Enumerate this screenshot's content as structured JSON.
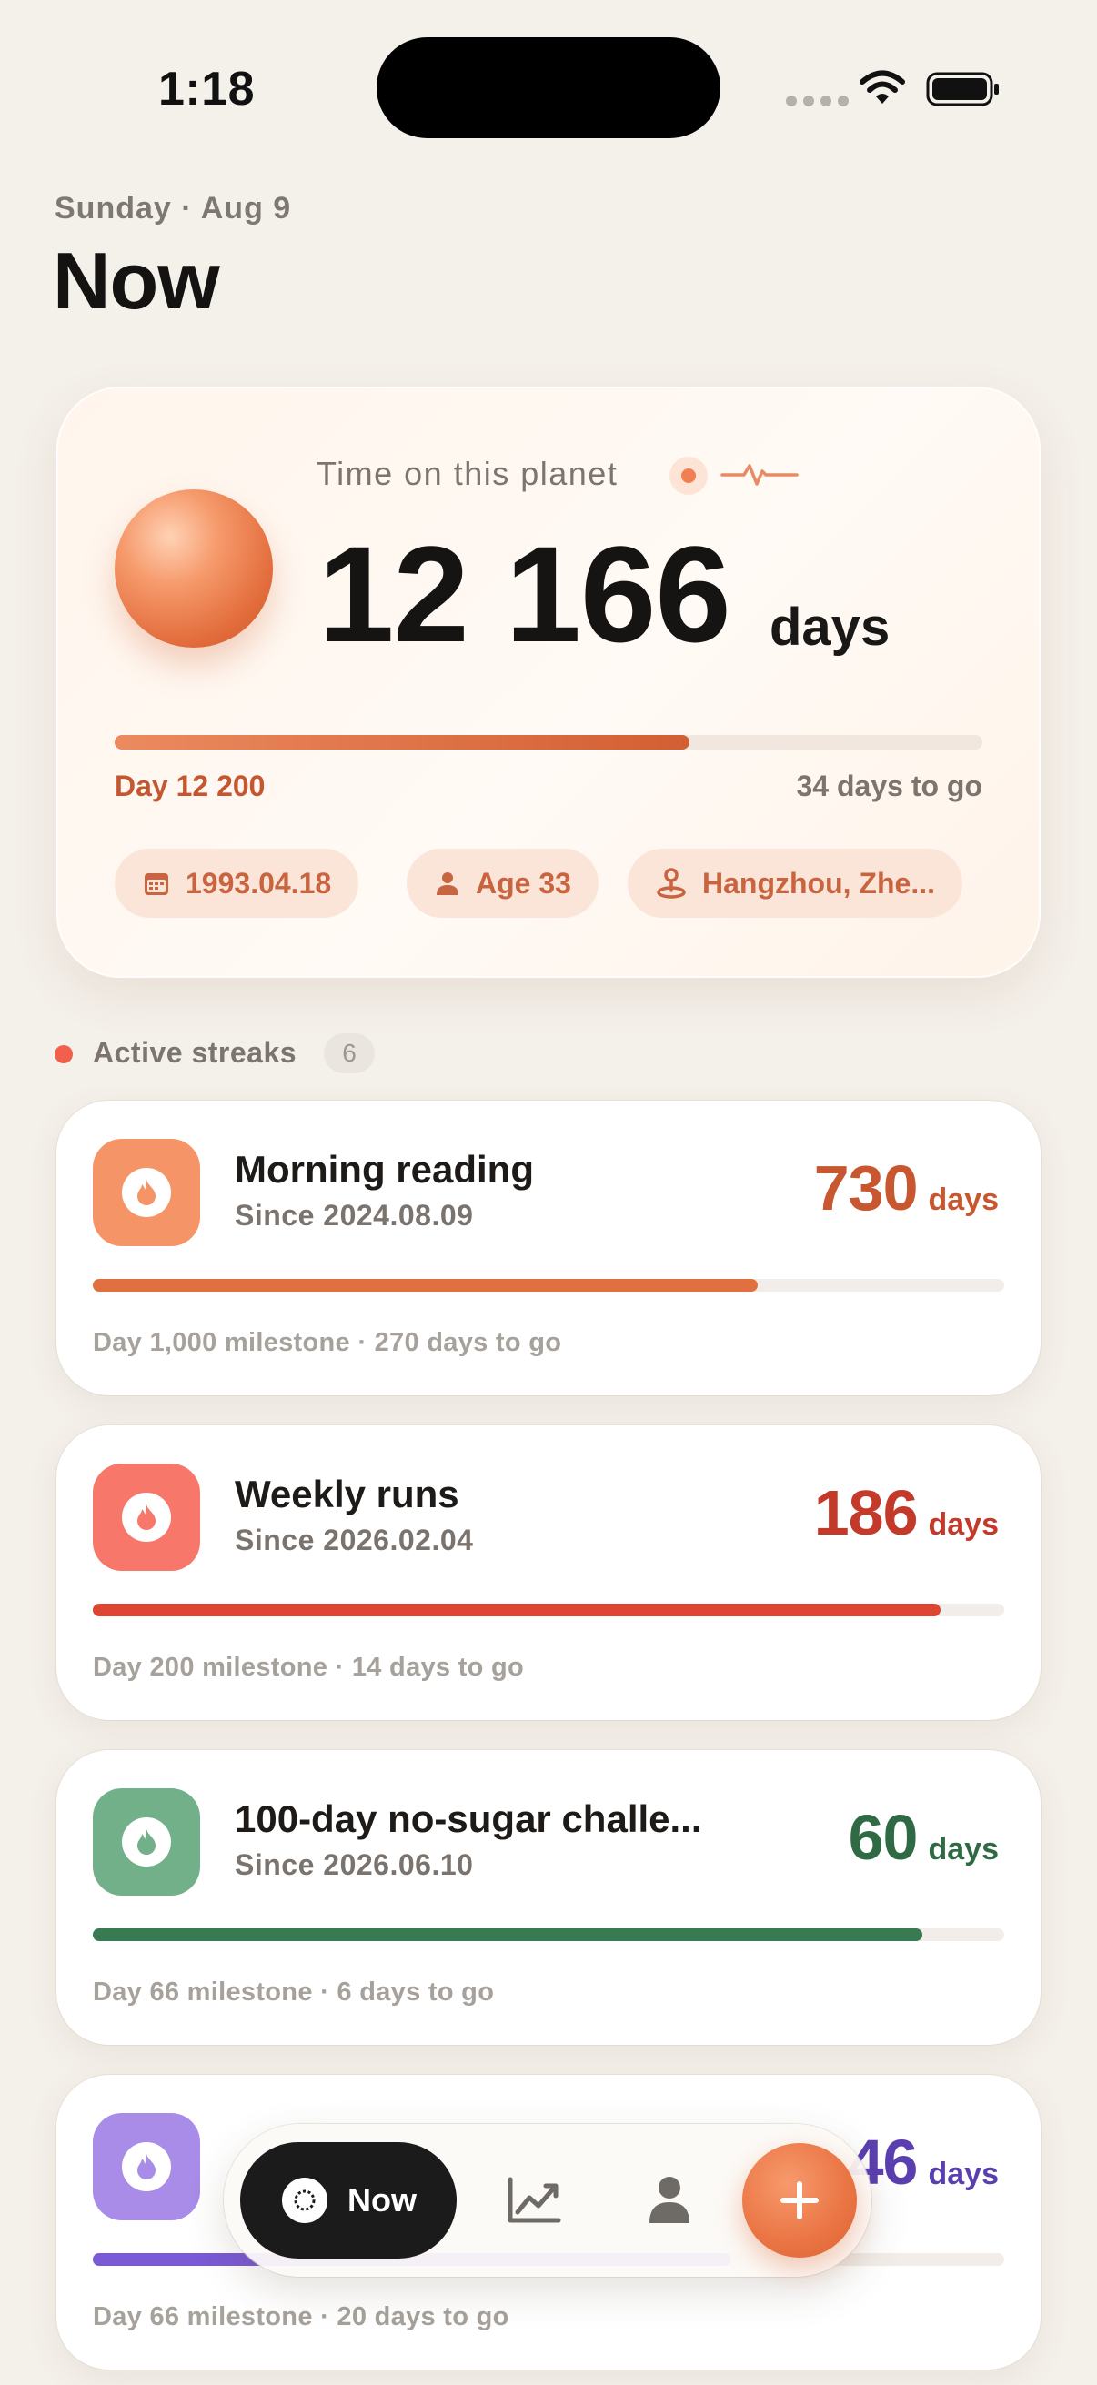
{
  "status_bar": {
    "time": "1:18"
  },
  "header": {
    "date": "Sunday · Aug 9",
    "title": "Now"
  },
  "hero": {
    "label": "Time on this planet",
    "value": "12 166",
    "unit": "days",
    "progress": 0.662,
    "milestone": "Day 12 200",
    "remaining": "34 days to go",
    "chips": [
      {
        "icon": "calendar-icon",
        "text": "1993.04.18"
      },
      {
        "icon": "person-icon",
        "text": "Age 33"
      },
      {
        "icon": "location-pin-icon",
        "text": "Hangzhou, Zhe..."
      }
    ]
  },
  "streaks_section": {
    "title": "Active streaks",
    "count": "6"
  },
  "streaks": [
    {
      "name": "Morning reading",
      "since": "Since 2024.08.09",
      "count": "730",
      "unit": "days",
      "progress": 0.73,
      "footer": "Day 1,000 milestone · 270 days to go",
      "color": "#c8562e",
      "icon_bg": "#f59466",
      "bar": "#e0703f"
    },
    {
      "name": "Weekly runs",
      "since": "Since 2026.02.04",
      "count": "186",
      "unit": "days",
      "progress": 0.93,
      "footer": "Day 200 milestone · 14 days to go",
      "color": "#c43a2a",
      "icon_bg": "#f7776a",
      "bar": "#de4634"
    },
    {
      "name": "100-day no-sugar challe...",
      "since": "Since 2026.06.10",
      "count": "60",
      "unit": "days",
      "progress": 0.91,
      "footer": "Day 66 milestone · 6 days to go",
      "color": "#2f6a45",
      "icon_bg": "#72b08a",
      "bar": "#3a7a52"
    },
    {
      "name": "",
      "since": "",
      "count": "46",
      "unit": "days",
      "progress": 0.7,
      "footer": "Day 66 milestone · 20 days to go",
      "color": "#5a3fb0",
      "icon_bg": "#a88ce8",
      "bar": "#7a5ad6"
    }
  ],
  "tabbar": {
    "now_label": "Now"
  }
}
